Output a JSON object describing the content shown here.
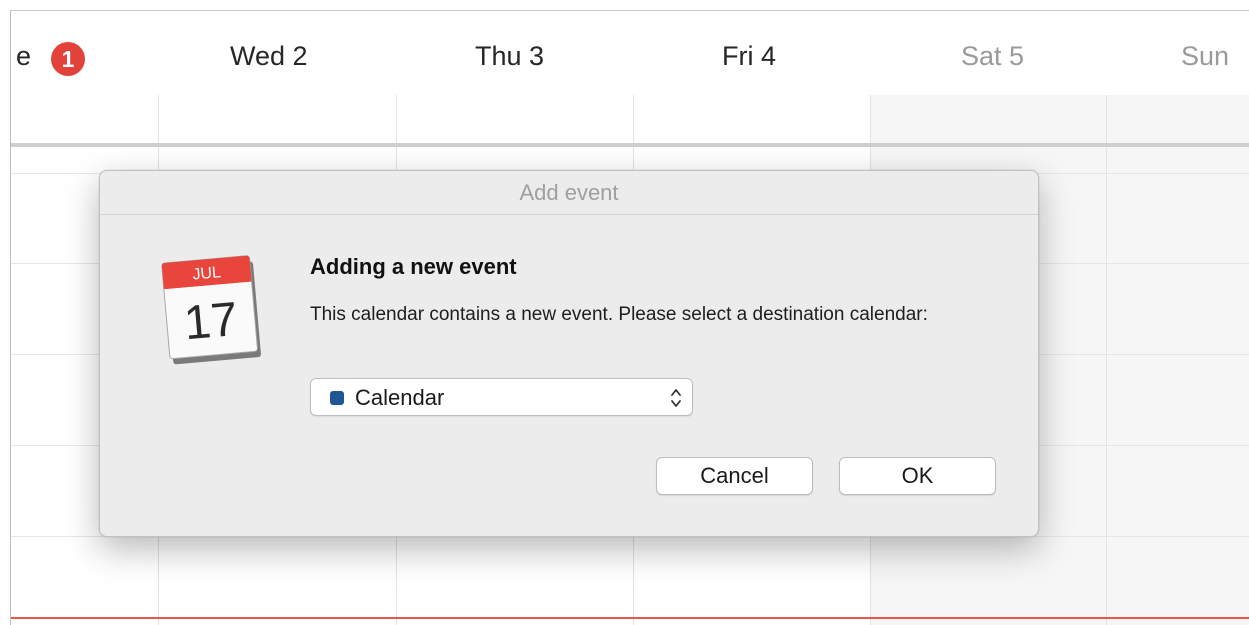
{
  "week": {
    "badge": "1",
    "partial_label": "e",
    "days": [
      {
        "label": "Wed 2",
        "weekend": false
      },
      {
        "label": "Thu 3",
        "weekend": false
      },
      {
        "label": "Fri 4",
        "weekend": false
      },
      {
        "label": "Sat 5",
        "weekend": true
      },
      {
        "label": "Sun",
        "weekend": true
      }
    ]
  },
  "dialog": {
    "title": "Add event",
    "heading": "Adding a new event",
    "message": "This calendar contains a new event. Please select a destination calendar:",
    "icon": {
      "name": "calendar-app-icon",
      "month": "JUL",
      "day": "17"
    },
    "calendar_select": {
      "value": "Calendar",
      "swatch_color": "#1f5796"
    },
    "cancel_label": "Cancel",
    "ok_label": "OK"
  },
  "colors": {
    "today_badge": "#e2423a",
    "now_line": "#e8574c"
  }
}
